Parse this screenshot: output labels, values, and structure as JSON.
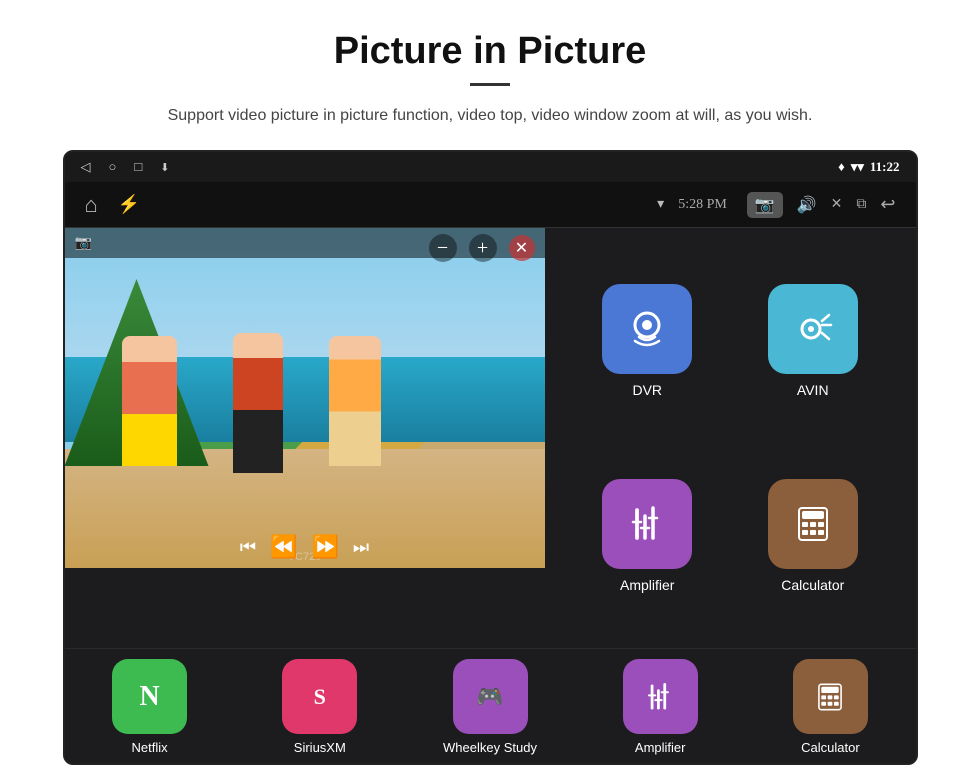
{
  "header": {
    "title": "Picture in Picture",
    "subtitle": "Support video picture in picture function, video top, video window zoom at will, as you wish.",
    "divider": true
  },
  "status_bar": {
    "back_icon": "◁",
    "home_icon": "○",
    "recent_icon": "□",
    "download_icon": "⬇",
    "gps_icon": "♦",
    "wifi_icon": "▾",
    "time": "11:22"
  },
  "car_toolbar": {
    "home_icon": "⌂",
    "usb_icon": "⚡",
    "wifi_signal": "▾",
    "time": "5:28 PM",
    "camera_icon": "📷",
    "volume_icon": "🔊",
    "close_icon": "✕",
    "pip_icon": "⧉",
    "back_icon": "↩"
  },
  "pip_player": {
    "resize_minus": "−",
    "resize_plus": "+",
    "close": "✕",
    "play_prev": "⏮",
    "rewind": "⏪",
    "play_next": "⏭",
    "camera_overlay": "📷"
  },
  "top_apps": [
    {
      "label": "Netflix",
      "color": "green-icon",
      "icon": "N"
    },
    {
      "label": "SiriusXM",
      "color": "pink-icon",
      "icon": "S"
    },
    {
      "label": "Wheelkey Study",
      "color": "purple-icon",
      "icon": "W"
    }
  ],
  "right_apps": [
    {
      "label": "DVR",
      "color": "blue-dvr",
      "icon": "dvr"
    },
    {
      "label": "AVIN",
      "color": "blue-avin",
      "icon": "avin"
    }
  ],
  "bottom_apps": [
    {
      "label": "Netflix",
      "color": "green-icon"
    },
    {
      "label": "SiriusXM",
      "color": "pink-icon"
    },
    {
      "label": "Wheelkey Study",
      "color": "purple-icon"
    },
    {
      "label": "Amplifier",
      "color": "purple-amp",
      "icon": "amp"
    },
    {
      "label": "Calculator",
      "color": "brown-calc",
      "icon": "calc"
    }
  ]
}
